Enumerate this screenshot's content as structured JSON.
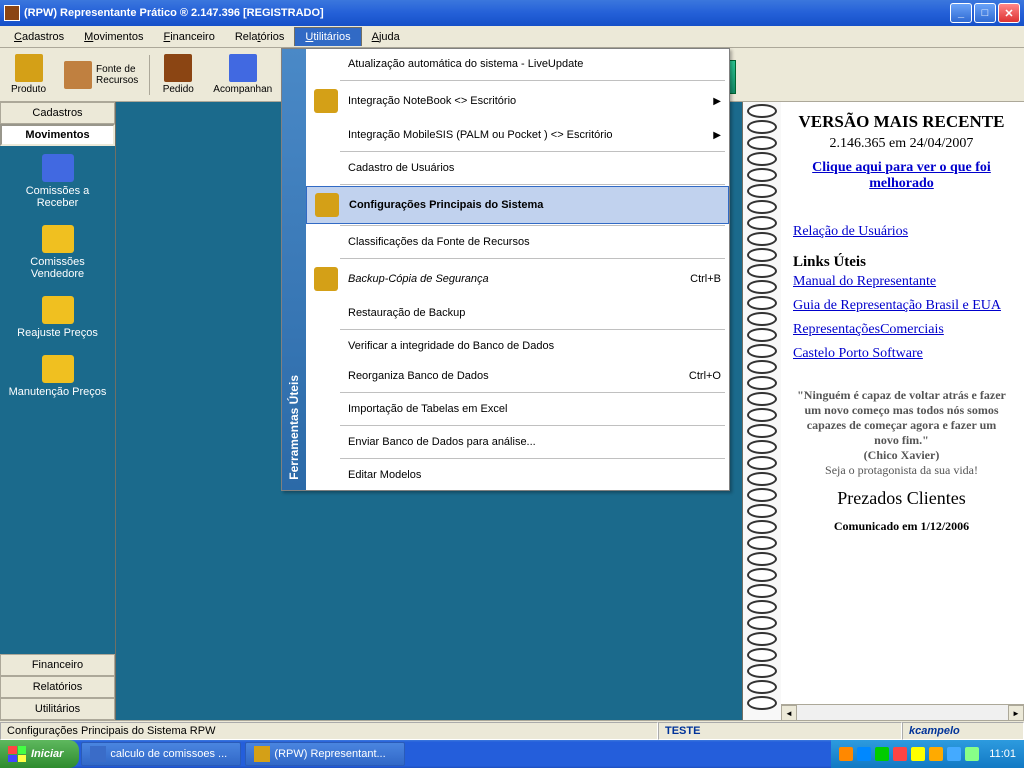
{
  "titlebar": {
    "text": "(RPW) Representante Prático ®  2.147.396 [REGISTRADO]"
  },
  "menubar": {
    "items": [
      {
        "label": "Cadastros",
        "u": "C"
      },
      {
        "label": "Movimentos",
        "u": "M"
      },
      {
        "label": "Financeiro",
        "u": "F"
      },
      {
        "label": "Relatórios",
        "u": "R"
      },
      {
        "label": "Utilitários",
        "u": "U",
        "active": true
      },
      {
        "label": "Ajuda",
        "u": "A"
      }
    ]
  },
  "toolbar": {
    "produto": "Produto",
    "fonte": "Fonte de\nRecursos",
    "pedido": "Pedido",
    "acompanhar": "Acompanhan"
  },
  "sidebar": {
    "tabs": {
      "cadastros": "Cadastros",
      "movimentos": "Movimentos",
      "financeiro": "Financeiro",
      "relatorios": "Relatórios",
      "utilitarios": "Utilitários"
    },
    "items": [
      "Comissões a Receber",
      "Comissões Vendedore",
      "Reajuste Preços",
      "Manutenção Preços"
    ]
  },
  "dropdown": {
    "sidebar_text": "Ferramentas Úteis",
    "items": [
      {
        "label": "Atualização automática do sistema - LiveUpdate"
      },
      {
        "label": "Integração NoteBook <> Escritório",
        "icon": true,
        "arrow": true,
        "sep_before": true
      },
      {
        "label": "Integração MobileSIS (PALM ou Pocket ) <> Escritório",
        "arrow": true
      },
      {
        "label": "Cadastro de Usuários",
        "sep_before": true
      },
      {
        "label": "Configurações Principais do Sistema",
        "icon": true,
        "highlighted": true,
        "sep_before": true
      },
      {
        "label": "Classificações da Fonte de Recursos",
        "sep_before": true
      },
      {
        "label": "Backup-Cópia de Segurança",
        "icon": true,
        "shortcut": "Ctrl+B",
        "italic": true,
        "sep_before": true
      },
      {
        "label": "Restauração de Backup"
      },
      {
        "label": "Verificar a integridade do Banco de Dados",
        "sep_before": true
      },
      {
        "label": "Reorganiza Banco de Dados",
        "shortcut": "Ctrl+O"
      },
      {
        "label": "Importação de Tabelas em Excel",
        "sep_before": true
      },
      {
        "label": "Enviar Banco de Dados para análise...",
        "sep_before": true
      },
      {
        "label": "Editar Modelos",
        "sep_before": true
      }
    ]
  },
  "right_panel": {
    "title": "VERSÃO MAIS RECENTE",
    "version": "2.146.365 em 24/04/2007",
    "whats_new": "Clique aqui para ver o que foi melhorado",
    "users_link": "Relação de Usuários",
    "links_title": "Links Úteis",
    "links": [
      "Manual do Representante",
      "Guia de Representação Brasil e EUA",
      "RepresentaçõesComerciais",
      "Castelo Porto Software"
    ],
    "quote": "\"Ninguém é capaz de voltar atrás e fazer um novo começo mas todos nós somos capazes de começar agora e fazer um novo fim.\"",
    "quote_author": "(Chico Xavier)",
    "quote_epilog": "Seja o protagonista da sua vida!",
    "clients": "Prezados Clientes",
    "comm": "Comunicado em 1/12/2006"
  },
  "statusbar": {
    "main": "Configurações Principais do Sistema RPW",
    "teste": "TESTE",
    "user": "kcampelo"
  },
  "taskbar": {
    "start": "Iniciar",
    "items": [
      "calculo de comissoes ...",
      "(RPW) Representant..."
    ],
    "clock": "11:01"
  }
}
